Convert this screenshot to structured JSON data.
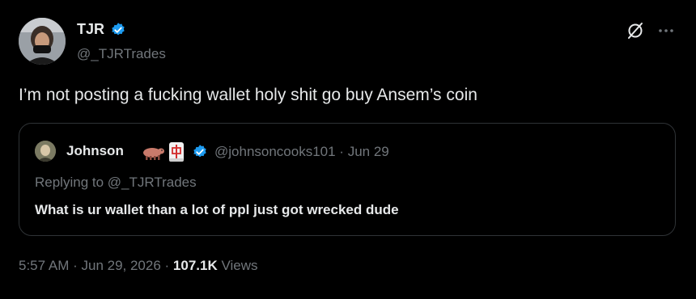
{
  "author": {
    "name": "TJR",
    "handle": "@_TJRTrades"
  },
  "tweet": {
    "text": "I’m not posting a fucking wallet holy shit go buy Ansem’s coin"
  },
  "quoted": {
    "name": "Johnson",
    "emoji": [
      "cow-emoji",
      "mahjong-red-dragon-emoji"
    ],
    "handle_date": "@johnsoncooks101 · Jun 29",
    "replying_to": "Replying to @_TJRTrades",
    "text": "What is ur wallet than a lot of ppl just got wrecked dude"
  },
  "meta": {
    "time": "5:57 AM",
    "sep1": " · ",
    "date": "Jun 29, 2026",
    "sep2": " · ",
    "views_count": "107.1K",
    "views_label": " Views"
  },
  "colors": {
    "background": "#000000",
    "text": "#e7e9ea",
    "secondary": "#71767b",
    "verified": "#1d9bf0",
    "border": "#2f3336"
  }
}
